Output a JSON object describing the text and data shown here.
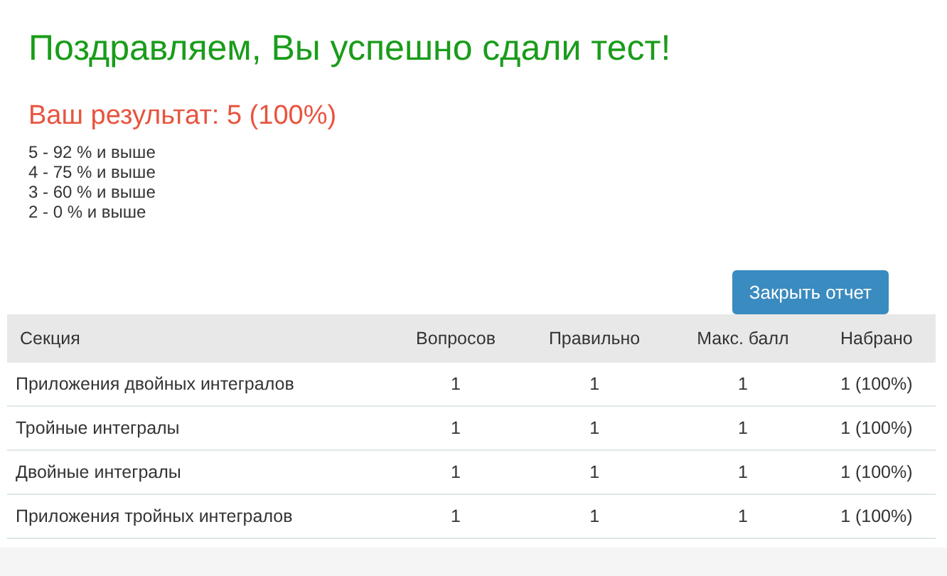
{
  "title": "Поздравляем, Вы успешно сдали тест!",
  "result": "Ваш результат: 5 (100%)",
  "scale": [
    "5 - 92 % и выше",
    "4 - 75 % и выше",
    "3 - 60 % и выше",
    "2 - 0 % и выше"
  ],
  "close_button": "Закрыть отчет",
  "table": {
    "columns": [
      "Секция",
      "Вопросов",
      "Правильно",
      "Макс. балл",
      "Набрано"
    ],
    "rows": [
      [
        "Приложения двойных интегралов",
        "1",
        "1",
        "1",
        "1 (100%)"
      ],
      [
        "Тройные интегралы",
        "1",
        "1",
        "1",
        "1 (100%)"
      ],
      [
        "Двойные интегралы",
        "1",
        "1",
        "1",
        "1 (100%)"
      ],
      [
        "Приложения тройных интегралов",
        "1",
        "1",
        "1",
        "1 (100%)"
      ]
    ]
  }
}
